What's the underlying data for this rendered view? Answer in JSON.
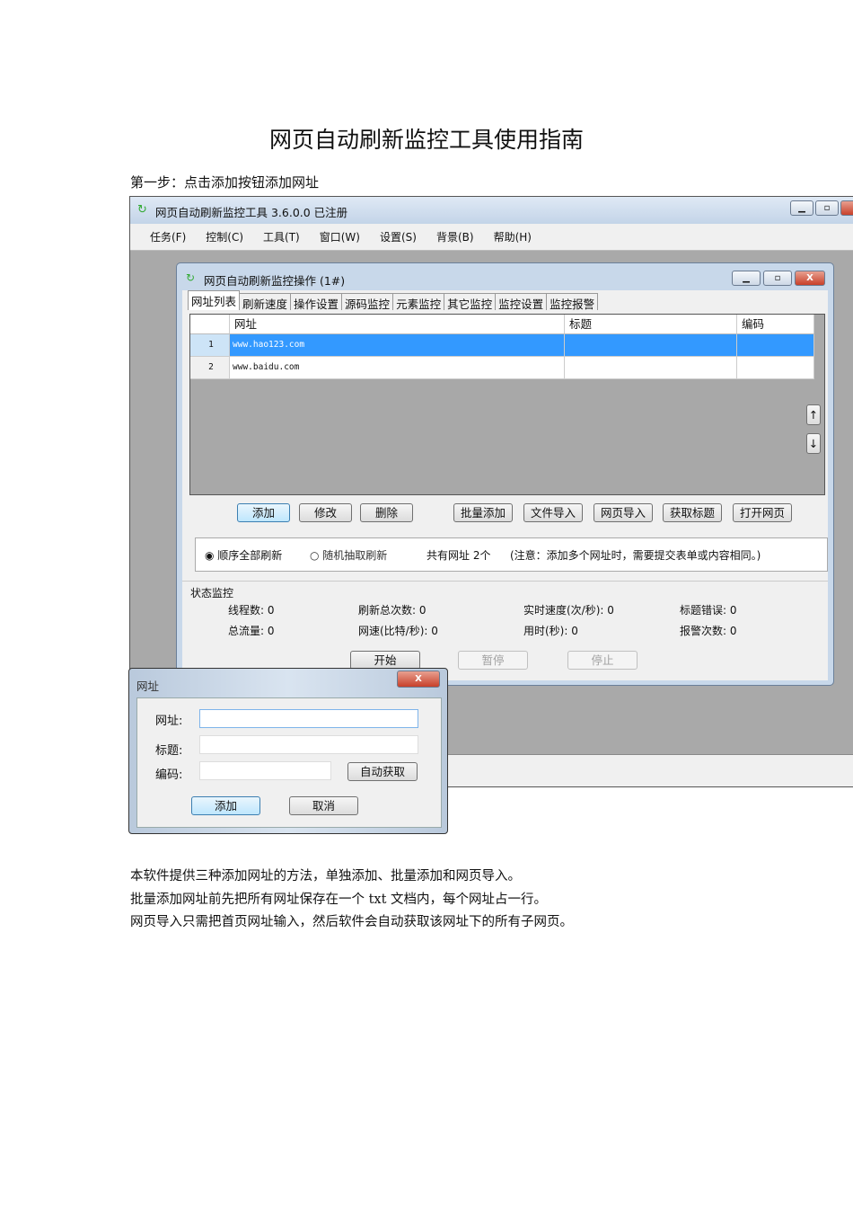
{
  "document": {
    "title": "网页自动刷新监控工具使用指南",
    "step": "第一步：点击添加按钮添加网址",
    "paragraphs": [
      "本软件提供三种添加网址的方法，单独添加、批量添加和网页导入。",
      "批量添加网址前先把所有网址保存在一个 txt 文档内，每个网址占一行。",
      "网页导入只需把首页网址输入，然后软件会自动获取该网址下的所有子网页。"
    ]
  },
  "app": {
    "title": "网页自动刷新监控工具 3.6.0.0 已注册",
    "menu": [
      "任务(F)",
      "控制(C)",
      "工具(T)",
      "窗口(W)",
      "设置(S)",
      "背景(B)",
      "帮助(H)"
    ]
  },
  "child": {
    "title": "网页自动刷新监控操作 (1#)",
    "tabs": [
      "网址列表",
      "刷新速度",
      "操作设置",
      "源码监控",
      "元素监控",
      "其它监控",
      "监控设置",
      "监控报警"
    ],
    "active_tab": "网址列表",
    "columns": [
      "网址",
      "标题",
      "编码"
    ],
    "rows": [
      {
        "n": "1",
        "url": "www.hao123.com",
        "title": "",
        "enc": "",
        "selected": true
      },
      {
        "n": "2",
        "url": "www.baidu.com",
        "title": "",
        "enc": "",
        "selected": false
      }
    ],
    "buttons": [
      "添加",
      "修改",
      "删除",
      "批量添加",
      "文件导入",
      "网页导入",
      "获取标题",
      "打开网页"
    ],
    "radio": {
      "options": [
        "顺序全部刷新",
        "随机抽取刷新"
      ],
      "selected": "顺序全部刷新"
    },
    "count_text": "共有网址 2个",
    "note": "(注意：添加多个网址时，需要提交表单或内容相同。)",
    "status": {
      "title": "状态监控",
      "items": [
        [
          "线程数: 0",
          "刷新总次数: 0",
          "实时速度(次/秒): 0",
          "标题错误: 0"
        ],
        [
          "总流量: 0",
          "网速(比特/秒): 0",
          "用时(秒): 0",
          "报警次数: 0"
        ]
      ]
    },
    "control": [
      "开始",
      "暂停",
      "停止"
    ]
  },
  "dialog": {
    "title": "网址",
    "labels": [
      "网址:",
      "标题:",
      "编码:"
    ],
    "values": [
      "",
      "",
      ""
    ],
    "auto_button": "自动获取",
    "add_button": "添加",
    "cancel_button": "取消"
  },
  "colors": {
    "selection": "#3399ff",
    "close": "#c8402a"
  }
}
